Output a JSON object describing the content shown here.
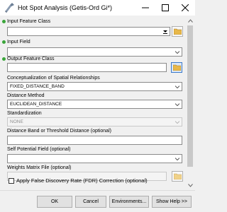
{
  "window": {
    "title": "Hot Spot Analysis (Getis-Ord Gi*)"
  },
  "params": {
    "input_feature_class": {
      "label": "Input Feature Class",
      "value": ""
    },
    "input_field": {
      "label": "Input Field",
      "value": ""
    },
    "output_feature_class": {
      "label": "Output Feature Class",
      "value": ""
    },
    "conceptualization": {
      "label": "Conceptualization of Spatial Relationships",
      "value": "FIXED_DISTANCE_BAND"
    },
    "distance_method": {
      "label": "Distance Method",
      "value": "EUCLIDEAN_DISTANCE"
    },
    "standardization": {
      "label": "Standardization",
      "value": "NONE"
    },
    "distance_band": {
      "label": "Distance Band or Threshold Distance (optional)",
      "value": ""
    },
    "self_potential": {
      "label": "Self Potential Field (optional)",
      "value": ""
    },
    "weights_matrix": {
      "label": "Weights Matrix File (optional)",
      "value": ""
    },
    "fdr": {
      "label": "Apply False Discovery Rate (FDR) Correction (optional)",
      "checked": false
    }
  },
  "buttons": {
    "ok": "OK",
    "cancel": "Cancel",
    "environments": "Environments...",
    "show_help": "Show Help >>"
  },
  "colors": {
    "required_dot": "#3aa53a",
    "folder_yellow": "#e8b84a",
    "active_border": "#3c78c8"
  }
}
